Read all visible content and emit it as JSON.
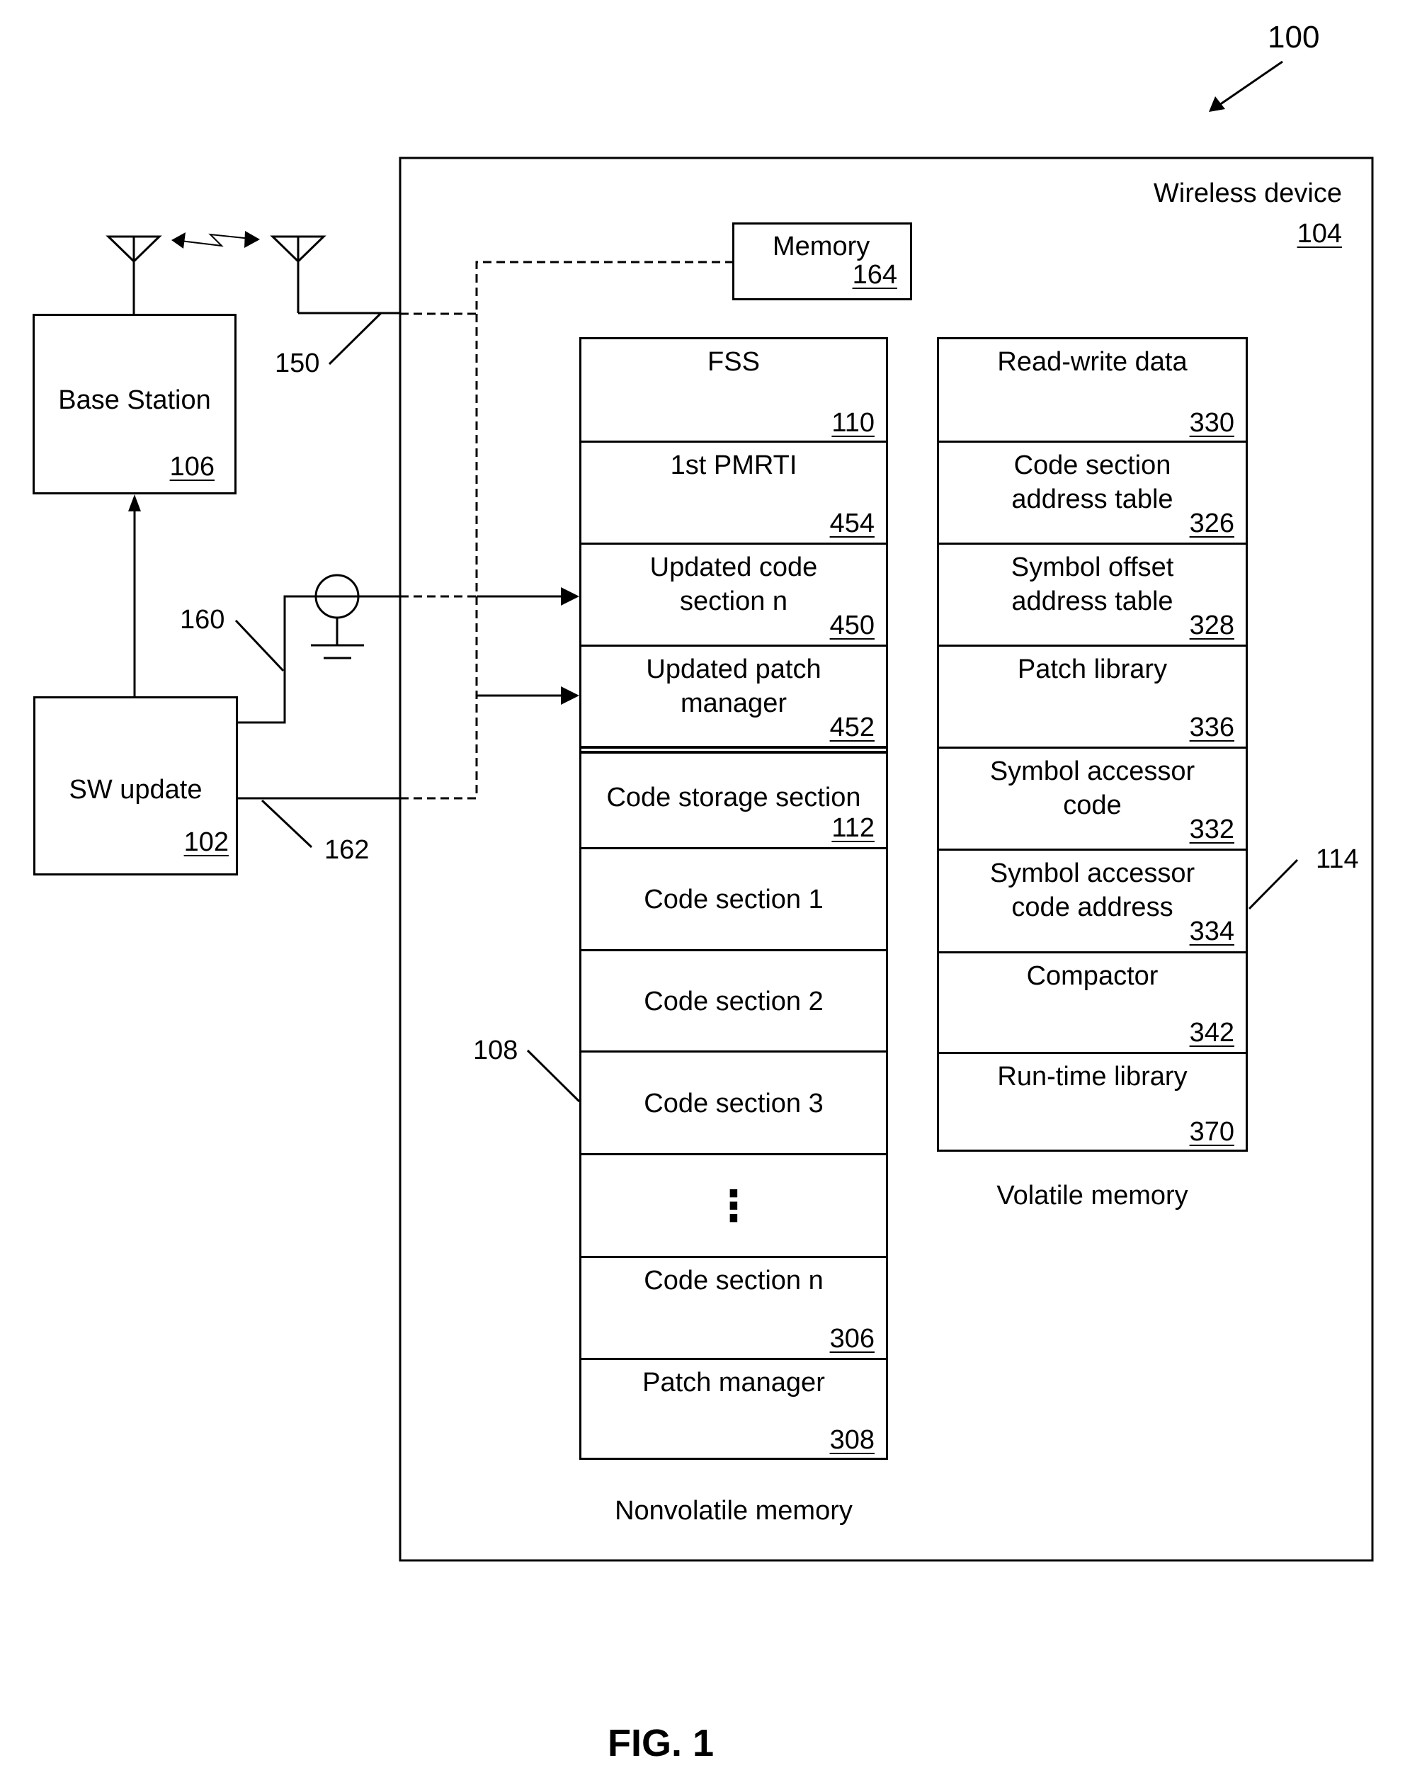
{
  "figure": {
    "ref_number": "100",
    "caption": "FIG. 1"
  },
  "base_station": {
    "label": "Base Station",
    "ref": "106"
  },
  "sw_update": {
    "label": "SW update",
    "ref": "102"
  },
  "wireless_device": {
    "label": "Wireless device",
    "ref": "104"
  },
  "memory": {
    "label": "Memory",
    "ref": "164"
  },
  "leaders": {
    "antenna_link": "150",
    "sw_link_160": "160",
    "sw_link_162": "162",
    "nonvolatile_ref": "108",
    "volatile_ref": "114"
  },
  "nonvolatile_memory": {
    "caption": "Nonvolatile memory",
    "cells": [
      {
        "label": "FSS",
        "ref": "110"
      },
      {
        "label": "1st PMRTI",
        "ref": "454"
      },
      {
        "label": "Updated code section n",
        "label_line1": "Updated code",
        "label_line2": "section n",
        "ref": "450"
      },
      {
        "label": "Updated patch manager",
        "label_line1": "Updated patch",
        "label_line2": "manager",
        "ref": "452"
      },
      {
        "label": "Code storage section",
        "ref": "112"
      },
      {
        "label": "Code section 1",
        "ref": ""
      },
      {
        "label": "Code section 2",
        "ref": ""
      },
      {
        "label": "Code section 3",
        "ref": ""
      },
      {
        "label": "⋮",
        "ref": ""
      },
      {
        "label": "Code section n",
        "ref": "306"
      },
      {
        "label": "Patch manager",
        "ref": "308"
      }
    ]
  },
  "volatile_memory": {
    "caption": "Volatile memory",
    "cells": [
      {
        "label": "Read-write data",
        "ref": "330"
      },
      {
        "label": "Code section address table",
        "label_line1": "Code section",
        "label_line2": "address table",
        "ref": "326"
      },
      {
        "label": "Symbol offset address table",
        "label_line1": "Symbol offset",
        "label_line2": "address table",
        "ref": "328"
      },
      {
        "label": "Patch library",
        "ref": "336"
      },
      {
        "label": "Symbol accessor code",
        "label_line1": "Symbol accessor",
        "label_line2": "code",
        "ref": "332"
      },
      {
        "label": "Symbol accessor code address",
        "label_line1": "Symbol accessor",
        "label_line2": "code address",
        "ref": "334"
      },
      {
        "label": "Compactor",
        "ref": "342"
      },
      {
        "label": "Run-time library",
        "ref": "370"
      }
    ]
  }
}
